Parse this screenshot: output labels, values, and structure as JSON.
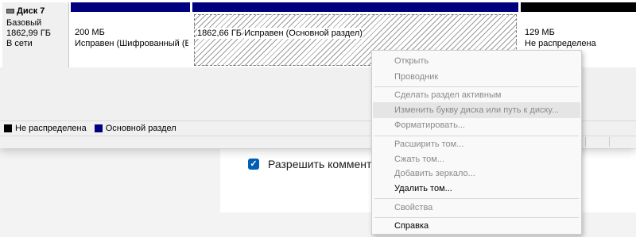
{
  "background": {
    "checkbox_label": "Разрешить комментар"
  },
  "disk": {
    "name": "Диск 7",
    "type": "Базовый",
    "size": "1862,99 ГБ",
    "status": "В сети"
  },
  "partitions": [
    {
      "size": "200 МБ",
      "status": "Исправен (Шифрованный (EF"
    },
    {
      "size": "1862,66 ГБ",
      "status": "Исправен (Основной раздел)"
    },
    {
      "size": "129 МБ",
      "status": "Не распределена"
    }
  ],
  "legend": [
    {
      "label": "Не распределена",
      "color": "#000000"
    },
    {
      "label": "Основной раздел",
      "color": "#00007f"
    }
  ],
  "context_menu": {
    "items": [
      {
        "label": "Открыть",
        "enabled": false
      },
      {
        "label": "Проводник",
        "enabled": false
      },
      {
        "label": "Сделать раздел активным",
        "enabled": false
      },
      {
        "label": "Изменить букву диска или путь к диску...",
        "enabled": false
      },
      {
        "label": "Форматировать...",
        "enabled": false
      },
      {
        "label": "Расширить том...",
        "enabled": false
      },
      {
        "label": "Сжать том...",
        "enabled": false
      },
      {
        "label": "Добавить зеркало...",
        "enabled": false
      },
      {
        "label": "Удалить том...",
        "enabled": true
      },
      {
        "label": "Свойства",
        "enabled": false
      },
      {
        "label": "Справка",
        "enabled": true
      }
    ]
  },
  "colors": {
    "primary_partition": "#00007f",
    "unallocated": "#000000",
    "checkbox_accent": "#005fb8"
  }
}
